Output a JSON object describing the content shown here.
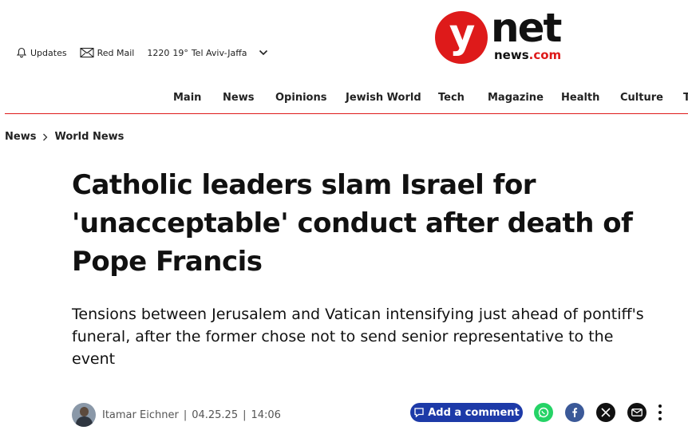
{
  "utility": {
    "updates_label": "Updates",
    "redmail_label": "Red Mail",
    "time": "1220",
    "temperature": "19°",
    "city": "Tel Aviv-Jaffa"
  },
  "logo": {
    "y": "y",
    "net": "net",
    "news": "news",
    "dotcom": ".com"
  },
  "nav": {
    "items": [
      "Main",
      "News",
      "Opinions",
      "Jewish World",
      "Tech",
      "Magazine",
      "Health",
      "Culture",
      "T"
    ]
  },
  "breadcrumb": {
    "items": [
      "News",
      "World News"
    ]
  },
  "article": {
    "headline": "Catholic leaders slam Israel for 'unacceptable' conduct after death of Pope Francis",
    "subhead": "Tensions between Jerusalem and Vatican intensifying just ahead of pontiff's funeral, after the former chose not to send senior representative to the event",
    "author": "Itamar Eichner",
    "date": "04.25.25",
    "time": "14:06"
  },
  "actions": {
    "comment_label": "Add a comment"
  },
  "colors": {
    "brand_red": "#de1a1a",
    "comment_blue": "#1d3aa8",
    "whatsapp": "#25d366",
    "facebook": "#3b5998"
  }
}
